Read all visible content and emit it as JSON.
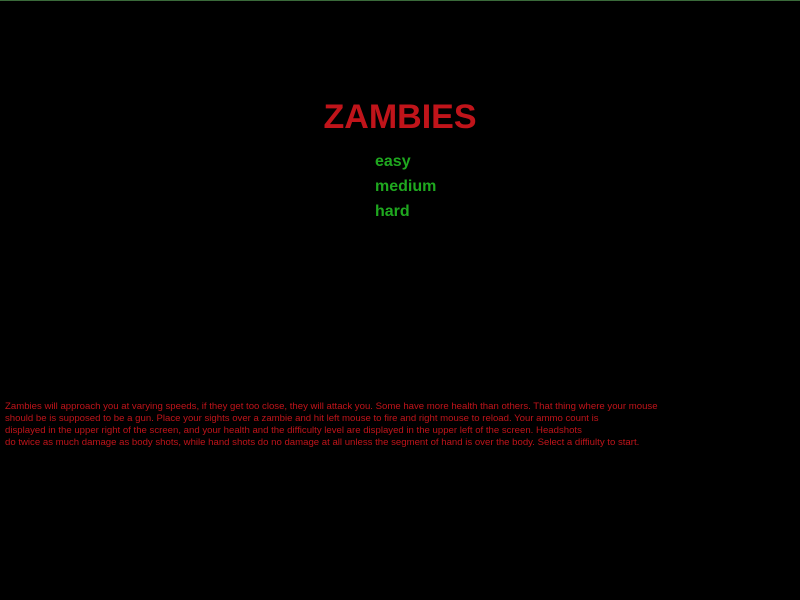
{
  "game": {
    "title": "ZAMBIES",
    "menu": [
      {
        "label": "easy"
      },
      {
        "label": "medium"
      },
      {
        "label": "hard"
      }
    ],
    "instructions": [
      "Zambies will approach you at varying speeds, if they get too close, they will attack you.  Some have more health than others.  That thing where your mouse",
      "should be is supposed to be a gun.  Place your sights over a zambie and hit left mouse to fire and right mouse to reload.  Your ammo count is",
      "displayed in the upper right of the screen, and your health and the difficulty level are displayed in the upper left of the screen.  Headshots",
      "do twice as much damage as body shots, while hand shots do no damage at all unless the segment of hand is over the body. Select a diffiulty to start."
    ]
  },
  "colors": {
    "background": "#000000",
    "title": "#c0141a",
    "menu": "#1fa81f",
    "instructions": "#c0141a"
  }
}
